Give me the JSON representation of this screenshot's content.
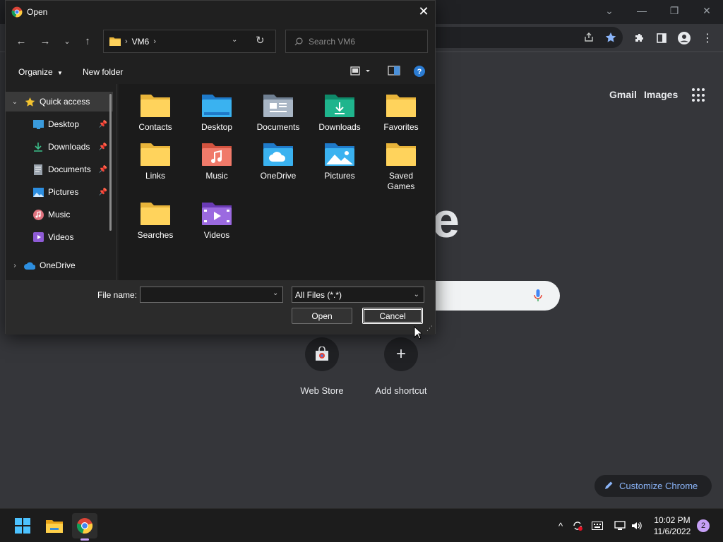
{
  "chrome": {
    "links": {
      "gmail": "Gmail",
      "images": "Images"
    },
    "logo_fragment": "e",
    "shortcuts": [
      {
        "label": "Web Store"
      },
      {
        "label": "Add shortcut"
      }
    ],
    "customize_label": "Customize Chrome"
  },
  "dialog": {
    "title": "Open",
    "address": {
      "folder": "VM6"
    },
    "search_placeholder": "Search VM6",
    "commands": {
      "organize": "Organize",
      "new_folder": "New folder"
    },
    "nav": [
      {
        "label": "Quick access"
      },
      {
        "label": "Desktop"
      },
      {
        "label": "Downloads"
      },
      {
        "label": "Documents"
      },
      {
        "label": "Pictures"
      },
      {
        "label": "Music"
      },
      {
        "label": "Videos"
      },
      {
        "label": "OneDrive"
      }
    ],
    "items": [
      {
        "label": "Contacts"
      },
      {
        "label": "Desktop"
      },
      {
        "label": "Documents"
      },
      {
        "label": "Downloads"
      },
      {
        "label": "Favorites"
      },
      {
        "label": "Links"
      },
      {
        "label": "Music"
      },
      {
        "label": "OneDrive"
      },
      {
        "label": "Pictures"
      },
      {
        "label": "Saved Games"
      },
      {
        "label": "Searches"
      },
      {
        "label": "Videos"
      }
    ],
    "file_name_label": "File name:",
    "file_name_value": "",
    "file_type": "All Files (*.*)",
    "open_button": "Open",
    "cancel_button": "Cancel"
  },
  "taskbar": {
    "time": "10:02 PM",
    "date": "11/6/2022",
    "notifications": "2"
  }
}
